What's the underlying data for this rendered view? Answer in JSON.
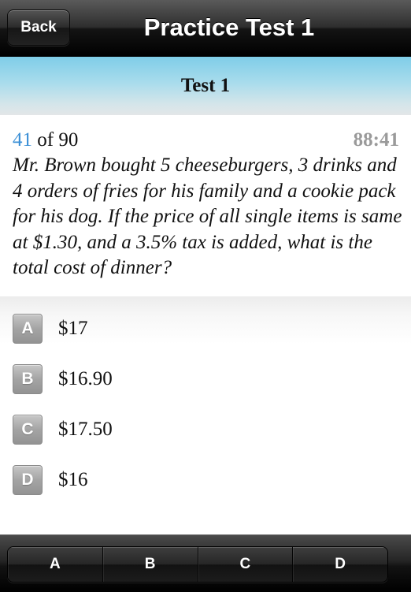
{
  "navbar": {
    "back_label": "Back",
    "title": "Practice Test 1"
  },
  "test_header": {
    "title": "Test 1"
  },
  "question": {
    "current": "41",
    "of_total": "of 90",
    "timer": "88:41",
    "text": "Mr. Brown bought 5 cheeseburgers, 3 drinks and 4 orders of fries for his family and a cookie pack for his dog. If the price of all single items is same at $1.30, and a 3.5% tax is added, what is the total cost of dinner?"
  },
  "options": [
    {
      "letter": "A",
      "text": "$17"
    },
    {
      "letter": "B",
      "text": "$16.90"
    },
    {
      "letter": "C",
      "text": "$17.50"
    },
    {
      "letter": "D",
      "text": "$16"
    }
  ],
  "answer_bar": {
    "buttons": [
      "A",
      "B",
      "C",
      "D"
    ]
  },
  "colors": {
    "accent_blue": "#3a8fd6",
    "timer_gray": "#9a9a9a",
    "band_top": "#7fcde8"
  }
}
